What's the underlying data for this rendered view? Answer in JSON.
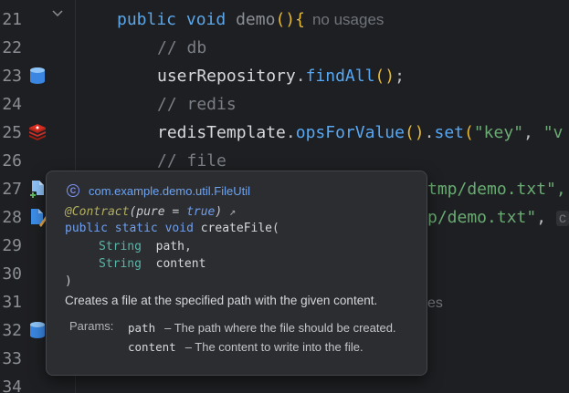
{
  "gutter": {
    "line_numbers": [
      "21",
      "22",
      "23",
      "24",
      "25",
      "26",
      "27",
      "28",
      "29",
      "30",
      "31",
      "32",
      "33",
      "34"
    ]
  },
  "code": {
    "l21": {
      "kw1": "public",
      "kw2": "void",
      "name": "demo",
      "open": "()",
      "brace": "{",
      "hint": "no usages"
    },
    "l22": {
      "comment": "// db"
    },
    "l23": {
      "obj": "userRepository",
      "dot": ".",
      "method": "findAll",
      "parens": "()",
      "semi": ";"
    },
    "l24": {
      "comment": "// redis"
    },
    "l25": {
      "obj": "redisTemplate",
      "dot1": ".",
      "method1": "opsForValue",
      "parens1": "()",
      "dot2": ".",
      "method2": "set",
      "open": "(",
      "str1": "\"key\"",
      "comma": ", ",
      "str2": "\"v"
    },
    "l26": {
      "comment": "// file"
    },
    "l27": {
      "tail": "tmp/demo.txt\","
    },
    "l28": {
      "tail": "p/demo.txt\"",
      "comma": ",",
      "hint": "c"
    },
    "l31": {
      "tail": "es"
    }
  },
  "popup": {
    "class_icon": "C",
    "class_name": "com.example.demo.util.FileUtil",
    "annotation": "@Contract",
    "annotation_args_open": "(",
    "annotation_arg_name": "pure",
    "annotation_eq": " = ",
    "annotation_arg_value": "true",
    "annotation_close": ")",
    "annotation_link": "↗",
    "sig_public": "public",
    "sig_static": "static",
    "sig_void": "void",
    "sig_method": "createFile",
    "sig_open": "(",
    "param1_type": "String",
    "param1_name": "path",
    "param1_comma": ",",
    "param2_type": "String",
    "param2_name": "content",
    "sig_close": ")",
    "description": "Creates a file at the specified path with the given content.",
    "params_label": "Params:",
    "params": [
      {
        "name": "path",
        "desc": "– The path where the file should be created."
      },
      {
        "name": "content",
        "desc": "– The content to write into the file."
      }
    ]
  },
  "icons": {
    "line23": "database-icon",
    "line25": "redis-icon",
    "line27": "new-file-icon",
    "line28": "edit-file-icon",
    "line32": "database-icon",
    "fold21": "chevron-down-icon"
  },
  "colors": {
    "editor_bg": "#1e1f22",
    "popup_bg": "#2b2d30",
    "keyword": "#5ba7e9",
    "comment": "#7a7e85",
    "string": "#6aab73",
    "method": "#56a8f5"
  }
}
